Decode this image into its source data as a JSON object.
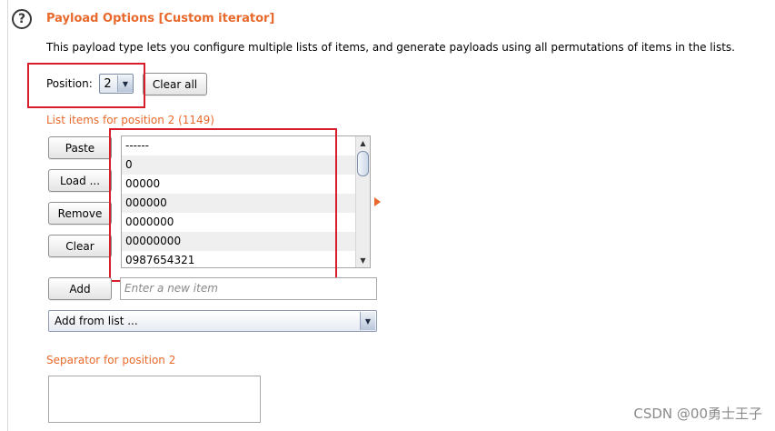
{
  "section": {
    "help_icon_glyph": "?",
    "title": "Payload Options [Custom iterator]",
    "description": "This payload type lets you configure multiple lists of items, and generate payloads using all permutations of items in the lists."
  },
  "position": {
    "label": "Position:",
    "value": "2",
    "clear_all_label": "Clear all"
  },
  "list": {
    "label": "List items for position 2 (1149)",
    "buttons": {
      "paste": "Paste",
      "load": "Load ...",
      "remove": "Remove",
      "clear": "Clear",
      "add": "Add"
    },
    "items": [
      "------",
      "0",
      "00000",
      "000000",
      "0000000",
      "00000000",
      "0987654321"
    ],
    "new_item_placeholder": "Enter a new item",
    "add_from_list": "Add from list ..."
  },
  "separator": {
    "label": "Separator for position 2",
    "value": ""
  },
  "watermark": "CSDN @00勇士王子",
  "colors": {
    "accent": "#e8692b",
    "highlight_box": "#d71e2a"
  }
}
